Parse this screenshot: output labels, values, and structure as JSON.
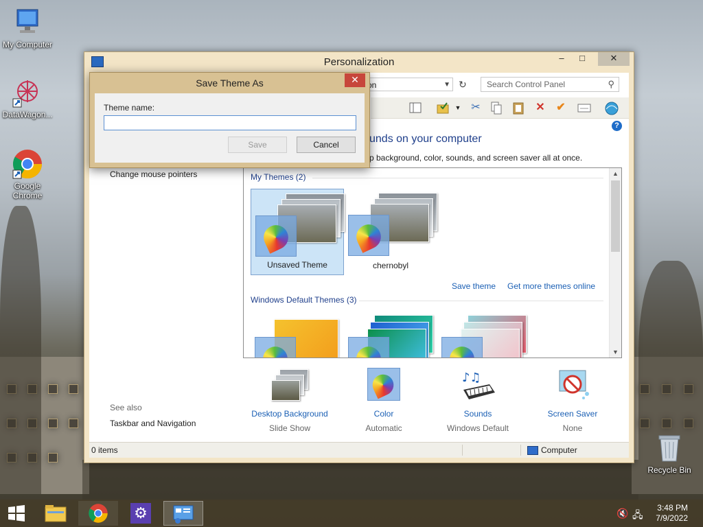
{
  "desktop": {
    "icons": [
      {
        "label": "My Computer"
      },
      {
        "label": "DataWagon..."
      },
      {
        "label": "Google Chrome"
      },
      {
        "label": "Recycle Bin"
      }
    ]
  },
  "window": {
    "title": "Personalization",
    "controls": {
      "minimize": "–",
      "maximize": "□",
      "close": "✕"
    },
    "address_fragment": "on",
    "search_placeholder": "Search Control Panel",
    "heading_fragment": "unds on your computer",
    "subtext_fragment": "p background, color, sounds, and screen saver all at once.",
    "left_links": [
      "Change mouse pointers"
    ],
    "see_also_label": "See also",
    "see_also_links": [
      "Taskbar and Navigation"
    ],
    "themes": {
      "my_themes_header": "My Themes (2)",
      "my_themes": [
        {
          "name": "Unsaved Theme",
          "selected": true
        },
        {
          "name": "chernobyl",
          "selected": false
        }
      ],
      "save_theme_link": "Save theme",
      "get_more_link": "Get more themes online",
      "default_themes_header": "Windows Default Themes (3)"
    },
    "bottom_items": [
      {
        "title": "Desktop Background",
        "subtitle": "Slide Show"
      },
      {
        "title": "Color",
        "subtitle": "Automatic"
      },
      {
        "title": "Sounds",
        "subtitle": "Windows Default"
      },
      {
        "title": "Screen Saver",
        "subtitle": "None"
      }
    ],
    "status": {
      "items": "0 items",
      "location": "Computer"
    }
  },
  "dialog": {
    "title": "Save Theme As",
    "close": "✕",
    "label": "Theme name:",
    "input_value": "",
    "save_label": "Save",
    "cancel_label": "Cancel"
  },
  "taskbar": {
    "time": "3:48 PM",
    "date": "7/9/2022"
  },
  "colors": {
    "window_frame": "#f3e5c7",
    "dialog_frame": "#d8c193",
    "link": "#1a5fb4",
    "heading": "#1f3f8b",
    "close_red": "#c7463b"
  }
}
